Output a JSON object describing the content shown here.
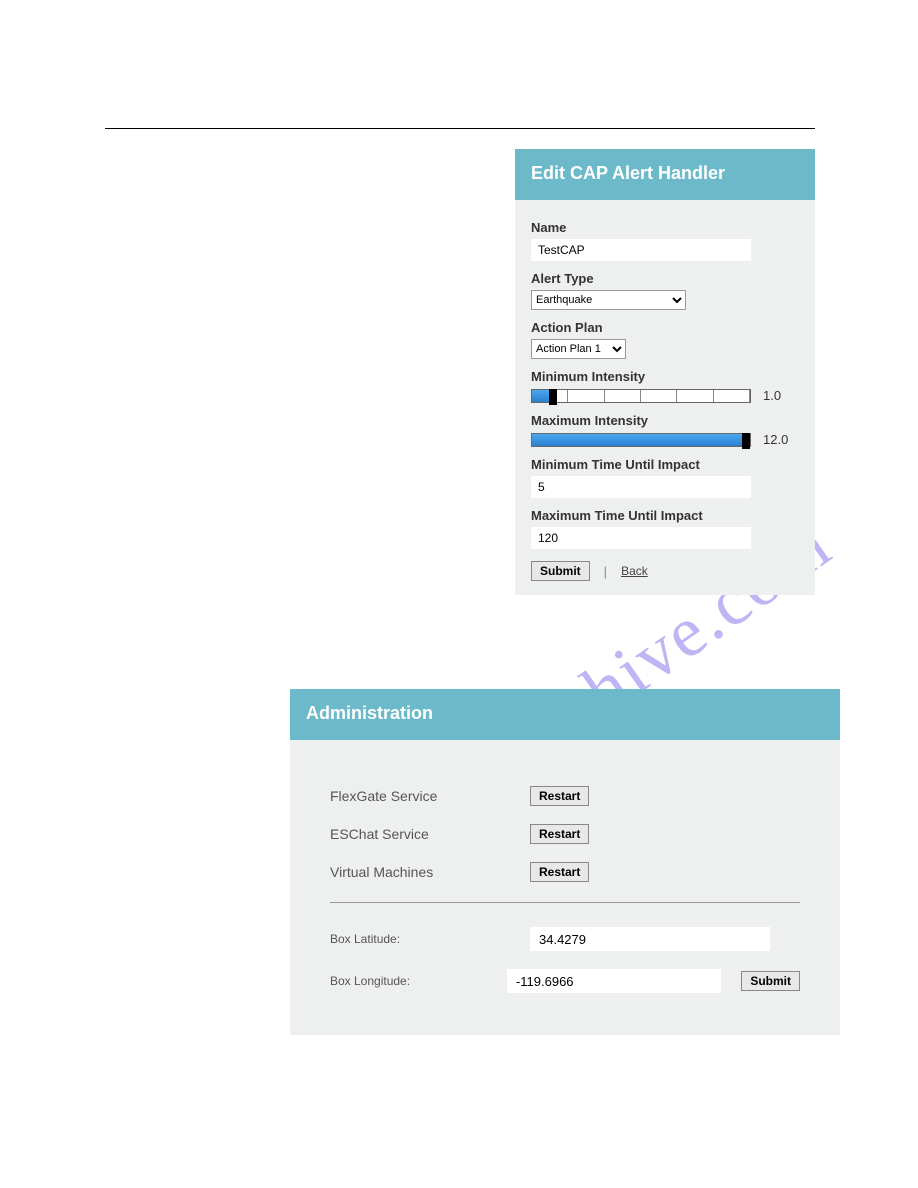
{
  "watermark": "manualshive.com",
  "cap_panel": {
    "title": "Edit CAP Alert Handler",
    "name_label": "Name",
    "name_value": "TestCAP",
    "alert_type_label": "Alert Type",
    "alert_type_value": "Earthquake",
    "action_plan_label": "Action Plan",
    "action_plan_value": "Action Plan 1",
    "min_intensity_label": "Minimum Intensity",
    "min_intensity_value": "1.0",
    "max_intensity_label": "Maximum Intensity",
    "max_intensity_value": "12.0",
    "min_time_label": "Minimum Time Until Impact",
    "min_time_value": "5",
    "max_time_label": "Maximum Time Until Impact",
    "max_time_value": "120",
    "submit_label": "Submit",
    "back_label": "Back",
    "divider": "|"
  },
  "admin_panel": {
    "title": "Administration",
    "services": [
      {
        "label": "FlexGate Service",
        "button": "Restart"
      },
      {
        "label": "ESChat Service",
        "button": "Restart"
      },
      {
        "label": "Virtual Machines",
        "button": "Restart"
      }
    ],
    "lat_label": "Box Latitude:",
    "lat_value": "34.4279",
    "lon_label": "Box Longitude:",
    "lon_value": "-119.6966",
    "submit_label": "Submit"
  }
}
